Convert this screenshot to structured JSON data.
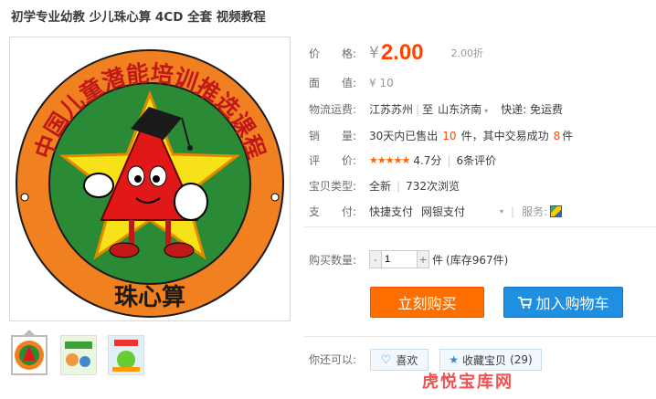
{
  "product": {
    "title": "初学专业幼教 少儿珠心算 4CD 全套 视频教程",
    "image_ring_text": "中国儿童潜能培训推选课程",
    "image_bottom_text": "珠心算"
  },
  "price": {
    "label": "价　　格:",
    "currency": "¥",
    "value": "2.00",
    "discount": "2.00折"
  },
  "face_value": {
    "label": "面　　值:",
    "value": "¥ 10"
  },
  "shipping": {
    "label": "物流运费:",
    "from": "江苏苏州",
    "to_sep": "至",
    "to": "山东济南",
    "express": "快递: 免运费"
  },
  "sales": {
    "label": "销　　量:",
    "prefix": "30天内已售出",
    "count": "10",
    "mid": "件，其中交易成功",
    "success": "8",
    "suffix": "件"
  },
  "rating": {
    "label": "评　　价:",
    "stars": "★★★★★",
    "score": "4.7分",
    "reviews": "6条评价"
  },
  "item_type": {
    "label": "宝贝类型:",
    "condition": "全新",
    "views": "732次浏览"
  },
  "payment": {
    "label": "支　　付:",
    "methods": [
      "快捷支付",
      "网银支付"
    ],
    "service_label": "服务:"
  },
  "quantity": {
    "label": "购买数量:",
    "value": "1",
    "unit": "件",
    "stock": "(库存967件)",
    "minus": "-",
    "plus": "+"
  },
  "buttons": {
    "buy": "立刻购买",
    "cart": "加入购物车"
  },
  "share": {
    "label": "你还可以:",
    "like": "喜欢",
    "favorite": "收藏宝贝",
    "fav_count": "(29)"
  },
  "watermark": "虎悦宝库网",
  "colors": {
    "price": "#ff4400",
    "buy_button": "#ff6f00",
    "cart_button": "#1e8fe1",
    "star": "#ff6600"
  }
}
